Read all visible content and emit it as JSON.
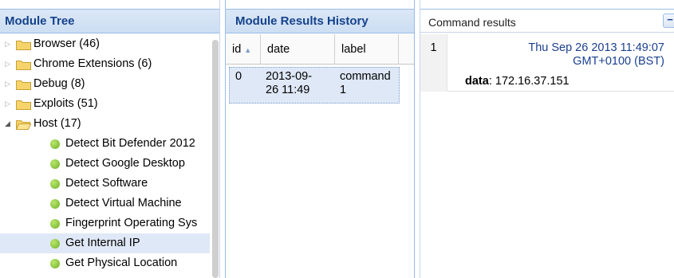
{
  "module_tree": {
    "title": "Module Tree",
    "categories": [
      {
        "label": "Browser (46)",
        "expanded": false
      },
      {
        "label": "Chrome Extensions (6)",
        "expanded": false
      },
      {
        "label": "Debug (8)",
        "expanded": false
      },
      {
        "label": "Exploits (51)",
        "expanded": false
      },
      {
        "label": "Host (17)",
        "expanded": true
      }
    ],
    "host_modules": [
      {
        "label": "Detect Bit Defender 2012"
      },
      {
        "label": "Detect Google Desktop"
      },
      {
        "label": "Detect Software"
      },
      {
        "label": "Detect Virtual Machine"
      },
      {
        "label": "Fingerprint Operating Sys"
      },
      {
        "label": "Get Internal IP",
        "selected": true
      },
      {
        "label": "Get Physical Location"
      }
    ]
  },
  "results_history": {
    "title": "Module Results History",
    "columns": {
      "id": "id",
      "date": "date",
      "label": "label"
    },
    "rows": [
      {
        "id": "0",
        "date": "2013-09-26 11:49",
        "label": "command 1"
      }
    ]
  },
  "command_results": {
    "title": "Command results",
    "collapse_glyph": "−",
    "entries": [
      {
        "num": "1",
        "timestamp": "Thu Sep 26 2013 11:49:07 GMT+0100 (BST)",
        "data_key": "data",
        "data_value": ": 172.16.37.151"
      }
    ]
  },
  "colors": {
    "header_text": "#15428b",
    "selection": "#dfe8f6",
    "node_dot": "#7dc13a"
  }
}
